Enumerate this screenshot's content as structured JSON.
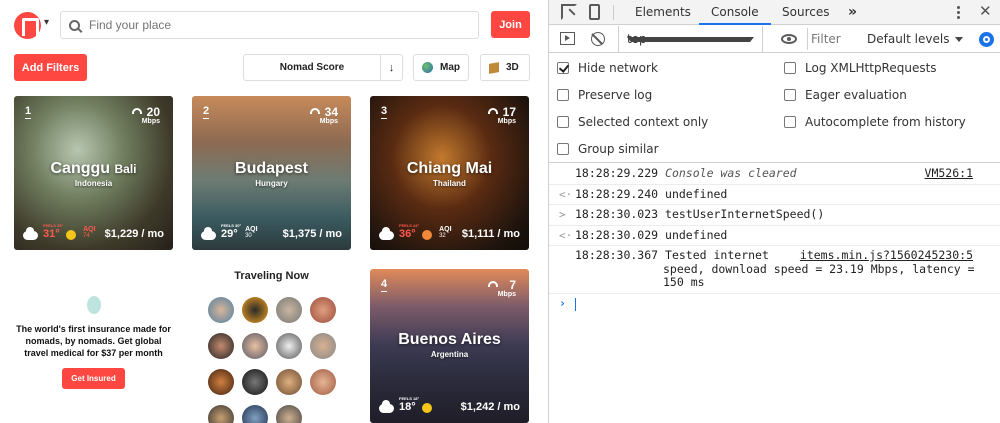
{
  "site": {
    "search_placeholder": "Find your place",
    "join_label": "Join",
    "add_filters_label": "Add Filters",
    "sort_label": "Nomad Score",
    "sort_direction_icon": "↓",
    "map_label": "Map",
    "threed_label": "3D",
    "cards": [
      {
        "rank": "1",
        "city": "Canggu",
        "city_extra": "Bali",
        "country": "Indonesia",
        "wifi": "20",
        "wifi_unit": "Mbps",
        "temp": "31°",
        "feels": "FEELS 35°",
        "aqi": "74",
        "price": "$1,229 / mo"
      },
      {
        "rank": "2",
        "city": "Budapest",
        "city_extra": "",
        "country": "Hungary",
        "wifi": "34",
        "wifi_unit": "Mbps",
        "temp": "29°",
        "feels": "FEELS 30°",
        "aqi": "30",
        "price": "$1,375 / mo"
      },
      {
        "rank": "3",
        "city": "Chiang Mai",
        "city_extra": "",
        "country": "Thailand",
        "wifi": "17",
        "wifi_unit": "Mbps",
        "temp": "36°",
        "feels": "FEELS 44°",
        "aqi": "32",
        "price": "$1,111 / mo"
      },
      {
        "rank": "4",
        "city": "Buenos Aires",
        "city_extra": "",
        "country": "Argentina",
        "wifi": "7",
        "wifi_unit": "Mbps",
        "temp": "18°",
        "feels": "FEELS 18°",
        "aqi": "",
        "price": "$1,242 / mo"
      }
    ],
    "aqi_label": "AQI",
    "ad": {
      "text": "The world's first insurance made for nomads, by nomads. Get global travel medical for $37 per month",
      "cta": "Get Insured"
    },
    "traveling_now": "Traveling Now"
  },
  "devtools": {
    "tabs": [
      "Elements",
      "Console",
      "Sources",
      "»"
    ],
    "context": "top",
    "filter_placeholder": "Filter",
    "levels": "Default levels",
    "settings": {
      "hide_network": "Hide network",
      "preserve_log": "Preserve log",
      "selected_context_only": "Selected context only",
      "group_similar": "Group similar",
      "log_xhr": "Log XMLHttpRequests",
      "eager_evaluation": "Eager evaluation",
      "autocomplete_history": "Autocomplete from history"
    },
    "console": [
      {
        "time": "18:28:29.229",
        "text": "Console was cleared",
        "source": "VM526:1"
      },
      {
        "prefix": "<·",
        "time": "18:28:29.240",
        "text": "undefined"
      },
      {
        "prefix": ">",
        "time": "18:28:30.023",
        "text": "testUserInternetSpeed()"
      },
      {
        "prefix": "<·",
        "time": "18:28:30.029",
        "text": "undefined"
      },
      {
        "time": "18:28:30.367",
        "text_line1": "Tested internet",
        "text_line2": "speed, download speed = 23.19 Mbps, latency =",
        "text_line3": "150 ms",
        "source": "items.min.js?1560245230:5"
      }
    ]
  },
  "colors": {
    "accent": "#ff4742",
    "devtools_blue": "#1a73e8"
  }
}
